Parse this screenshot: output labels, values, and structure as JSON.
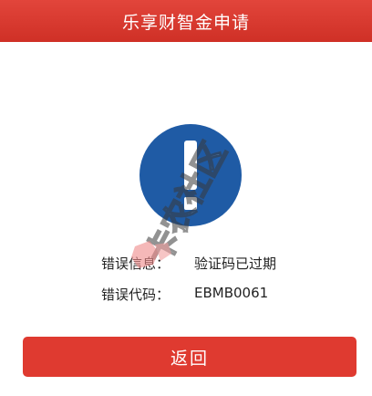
{
  "header": {
    "title": "乐享财智金申请"
  },
  "error": {
    "message_label": "错误信息：",
    "message_value": "验证码已过期",
    "code_label": "错误代码：",
    "code_value": "EBMB0061"
  },
  "actions": {
    "return_label": "返回"
  },
  "watermark": {
    "text": "卡农社区"
  },
  "colors": {
    "header": "#d8362c",
    "button": "#df3a30",
    "alert_circle": "#1f5ba5"
  },
  "icons": {
    "alert": "exclamation-circle-icon"
  }
}
